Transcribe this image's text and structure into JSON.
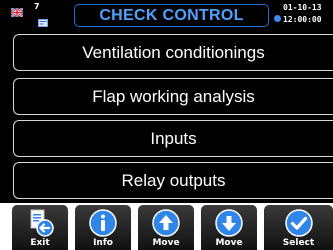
{
  "header": {
    "title": "CHECK CONTROL",
    "profile_number": "7",
    "date": "01-10-13",
    "time": "12:00:00",
    "flag_icon": "uk-flag-icon",
    "clock_icon": "clock-icon"
  },
  "menu": {
    "items": [
      {
        "label": "Ventilation conditionings"
      },
      {
        "label": "Flap working analysis"
      },
      {
        "label": "Inputs"
      },
      {
        "label": "Relay outputs"
      }
    ]
  },
  "toolbar": {
    "buttons": [
      {
        "label": "Exit",
        "icon": "exit-document-icon"
      },
      {
        "label": "Info",
        "icon": "info-icon"
      },
      {
        "label": "Move",
        "icon": "arrow-up-icon"
      },
      {
        "label": "Move",
        "icon": "arrow-down-icon"
      },
      {
        "label": "Select",
        "icon": "checkmark-icon"
      }
    ]
  },
  "colors": {
    "accent": "#4da2ff",
    "button_icon": "#2f86e8",
    "border": "#d8d8d8",
    "background": "#000000"
  }
}
